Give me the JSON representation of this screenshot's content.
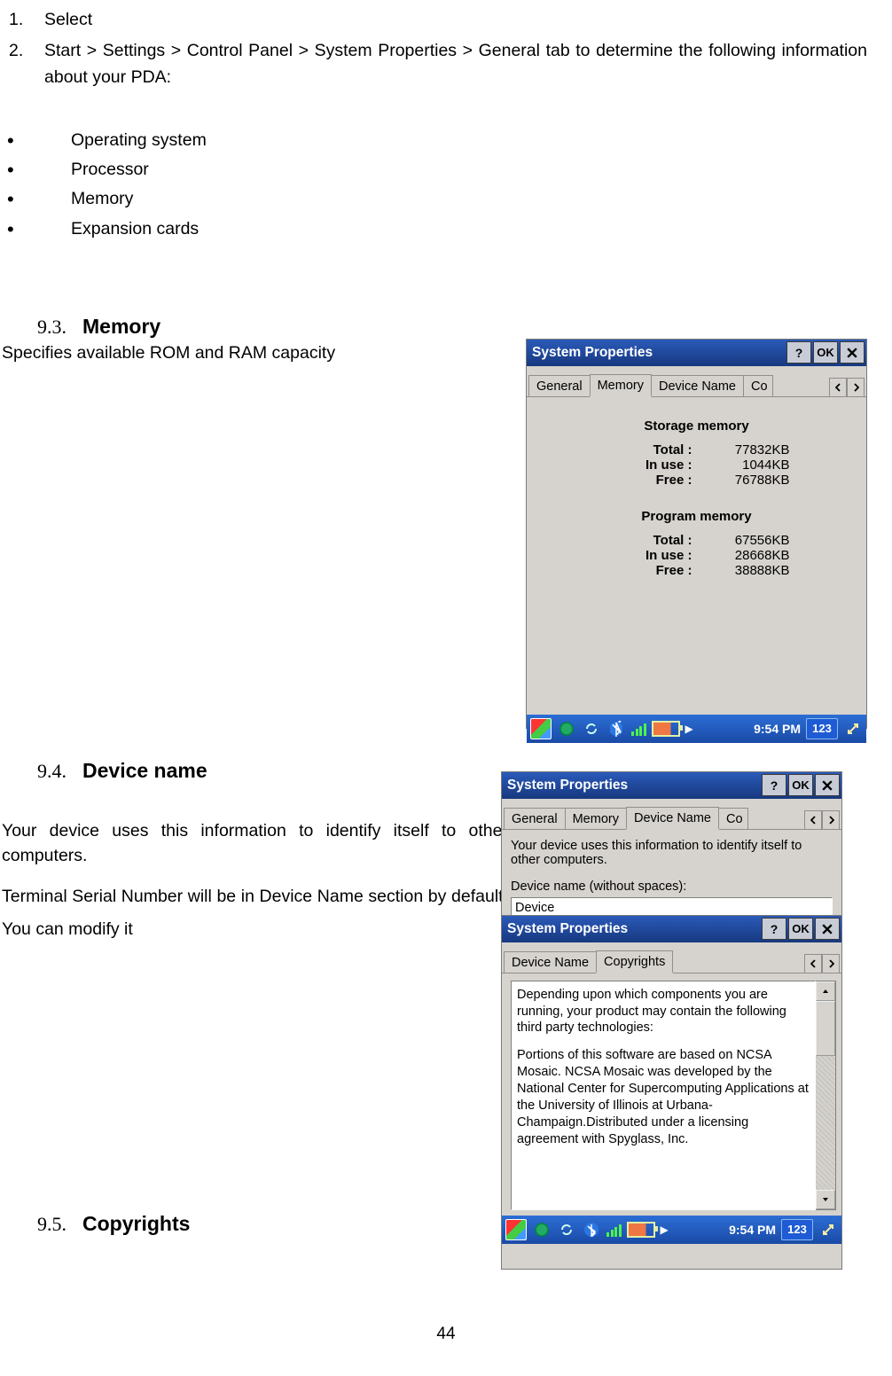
{
  "list": {
    "i1_num": "1.",
    "i1_txt": "Select",
    "i2_num": "2.",
    "i2_txt": "Start > Settings > Control Panel > System Properties > General tab to determine the following information about your PDA:"
  },
  "bullets": {
    "b1": "Operating system",
    "b2": "Processor",
    "b3": "Memory",
    "b4": "Expansion cards"
  },
  "s93": {
    "num": "9.3.",
    "title": "Memory",
    "p": "Specifies available ROM and RAM capacity"
  },
  "s94": {
    "num": "9.4.",
    "title": "Device name",
    "p1": "Your device uses this information to identify itself to other computers.",
    "p2": "Terminal Serial Number will be in Device Name section by default. You can modify it"
  },
  "s95": {
    "num": "9.5.",
    "title": "Copyrights"
  },
  "page_number": "44",
  "shot_mem": {
    "title": "System Properties",
    "help": "?",
    "ok": "OK",
    "tabs": {
      "general": "General",
      "memory": "Memory",
      "device_name": "Device Name",
      "cut": "Co"
    },
    "storage_hdr": "Storage memory",
    "program_hdr": "Program memory",
    "lbl_total": "Total :",
    "lbl_inuse": "In use :",
    "lbl_free": "Free :",
    "storage": {
      "total": "77832KB",
      "inuse": "1044KB",
      "free": "76788KB"
    },
    "program": {
      "total": "67556KB",
      "inuse": "28668KB",
      "free": "38888KB"
    },
    "clock": "9:54 PM",
    "kbd": "123"
  },
  "shot_dev": {
    "title": "System Properties",
    "help": "?",
    "ok": "OK",
    "tabs": {
      "general": "General",
      "memory": "Memory",
      "device_name": "Device Name",
      "cut": "Co"
    },
    "text": "Your device uses this information to identify itself to other computers.",
    "field_label": "Device name (without spaces):",
    "field_value": "Device"
  },
  "shot_copy": {
    "title": "System Properties",
    "help": "?",
    "ok": "OK",
    "tabs": {
      "device_name": "Device Name",
      "copyrights": "Copyrights"
    },
    "para1": "Depending upon which components you are running, your product may contain the following third party technologies:",
    "para2": "Portions of this software are based on NCSA Mosaic. NCSA Mosaic was developed by the National Center for Supercomputing Applications at the University of Illinois at Urbana-Champaign.Distributed under a licensing agreement with Spyglass, Inc.",
    "clock": "9:54 PM",
    "kbd": "123"
  }
}
